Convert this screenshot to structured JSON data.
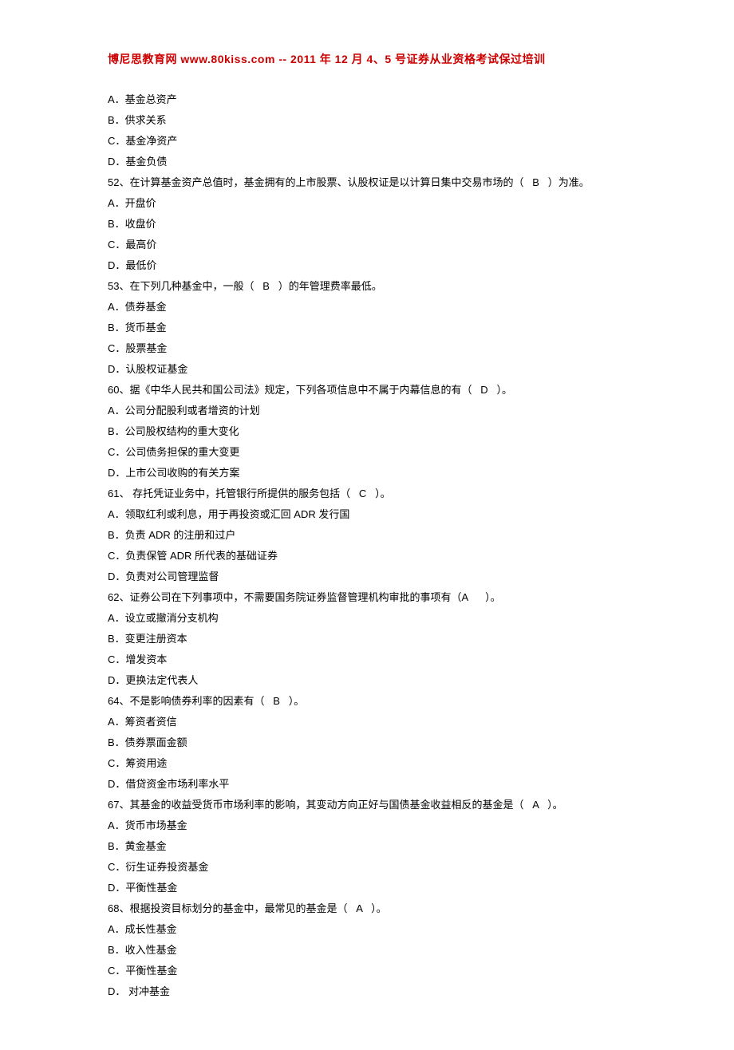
{
  "header": "博尼思教育网 www.80kiss.com -- 2011 年 12 月 4、5 号证券从业资格考试保过培训",
  "lines": [
    "A．基金总资产",
    "B．供求关系",
    "C．基金净资产",
    "D．基金负债",
    "52、在计算基金资产总值时，基金拥有的上市股票、认股权证是以计算日集中交易市场的（   B   ）为准。",
    "A．开盘价",
    "B．收盘价",
    "C．最高价",
    "D．最低价",
    "53、在下列几种基金中，一般（   B   ）的年管理费率最低。",
    "A．债券基金",
    "B．货币基金",
    "C．股票基金",
    "D．认股权证基金",
    "60、据《中华人民共和国公司法》规定，下列各项信息中不属于内幕信息的有（   D   ）。",
    "A．公司分配股利或者增资的计划",
    "B．公司股权结构的重大变化",
    "C．公司债务担保的重大变更",
    "D．上市公司收购的有关方案",
    "61、 存托凭证业务中，托管银行所提供的服务包括（   C   ）。",
    "A．领取红利或利息，用于再投资或汇回 ADR 发行国",
    "B．负责 ADR 的注册和过户",
    "C．负责保管 ADR 所代表的基础证券",
    "D．负责对公司管理监督",
    "62、证券公司在下列事项中，不需要国务院证券监督管理机构审批的事项有（A      ）。",
    "A．设立或撤消分支机构",
    "B．变更注册资本",
    "C．增发资本",
    "D．更换法定代表人",
    "64、不是影响债券利率的因素有（   B   ）。",
    "A．筹资者资信",
    "B．债券票面金额",
    "C．筹资用途",
    "D．借贷资金市场利率水平",
    "67、其基金的收益受货币市场利率的影响，其变动方向正好与国债基金收益相反的基金是（   A   ）。",
    "A．货币市场基金",
    "B．黄金基金",
    "C．衍生证券投资基金",
    "D．平衡性基金",
    "68、根据投资目标划分的基金中，最常见的基金是（   A   ）。",
    "A．成长性基金",
    "B．收入性基金",
    "C．平衡性基金",
    "D． 对冲基金"
  ]
}
